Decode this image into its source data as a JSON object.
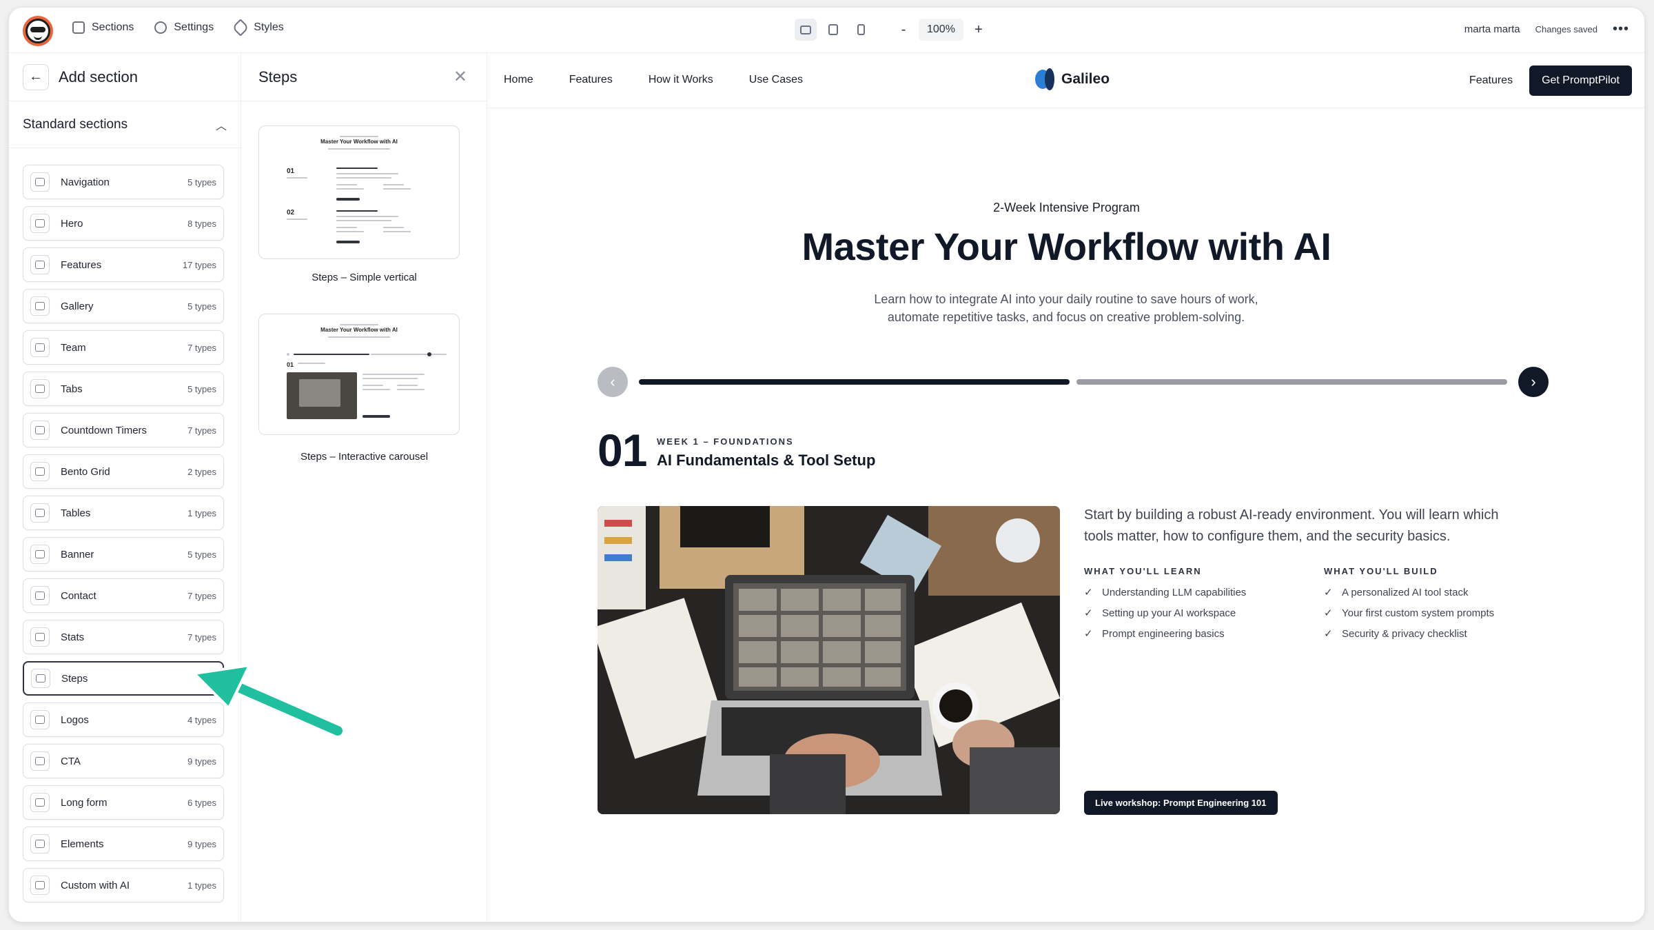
{
  "topbar": {
    "nav": [
      {
        "label": "Sections",
        "icon": "sections-icon"
      },
      {
        "label": "Settings",
        "icon": "gear-icon"
      },
      {
        "label": "Styles",
        "icon": "brush-icon"
      }
    ],
    "zoom_minus": "-",
    "zoom": "100%",
    "zoom_plus": "+",
    "user": "marta marta",
    "status": "Changes saved",
    "more": "•••"
  },
  "left_panel": {
    "title": "Add section",
    "group_title": "Standard sections",
    "items": [
      {
        "label": "Navigation",
        "count": "5 types",
        "icon": "navigation-icon"
      },
      {
        "label": "Hero",
        "count": "8 types",
        "icon": "hero-icon"
      },
      {
        "label": "Features",
        "count": "17 types",
        "icon": "features-icon"
      },
      {
        "label": "Gallery",
        "count": "5 types",
        "icon": "gallery-icon"
      },
      {
        "label": "Team",
        "count": "7 types",
        "icon": "team-icon"
      },
      {
        "label": "Tabs",
        "count": "5 types",
        "icon": "tabs-icon"
      },
      {
        "label": "Countdown Timers",
        "count": "7 types",
        "icon": "timer-icon"
      },
      {
        "label": "Bento Grid",
        "count": "2 types",
        "icon": "bento-grid-icon"
      },
      {
        "label": "Tables",
        "count": "1 types",
        "icon": "table-icon"
      },
      {
        "label": "Banner",
        "count": "5 types",
        "icon": "banner-icon"
      },
      {
        "label": "Contact",
        "count": "7 types",
        "icon": "phone-icon"
      },
      {
        "label": "Stats",
        "count": "7 types",
        "icon": "stats-icon"
      },
      {
        "label": "Steps",
        "count": "2",
        "icon": "steps-icon"
      },
      {
        "label": "Logos",
        "count": "4 types",
        "icon": "logos-icon"
      },
      {
        "label": "CTA",
        "count": "9 types",
        "icon": "cta-icon"
      },
      {
        "label": "Long form",
        "count": "6 types",
        "icon": "long-form-icon"
      },
      {
        "label": "Elements",
        "count": "9 types",
        "icon": "elements-icon"
      },
      {
        "label": "Custom with AI",
        "count": "1 types",
        "icon": "rocket-icon"
      }
    ]
  },
  "steps_panel": {
    "title": "Steps",
    "thumbs": [
      {
        "caption": "Steps – Simple vertical",
        "mini_title": "Master Your Workflow with AI",
        "n1": "01",
        "n2": "02"
      },
      {
        "caption": "Steps – Interactive carousel",
        "mini_title": "Master Your Workflow with AI",
        "n1": "01"
      }
    ]
  },
  "site": {
    "links": [
      "Home",
      "Features",
      "How it Works",
      "Use Cases"
    ],
    "brand": "Galileo",
    "right_link": "Features",
    "cta": "Get PromptPilot",
    "eyebrow": "2-Week Intensive Program",
    "title": "Master Your Workflow with AI",
    "subtitle": "Learn how to integrate AI into your daily routine to save hours of work, automate repetitive tasks, and focus on creative problem-solving.",
    "progress": {
      "current_step": 1,
      "total_steps": 2,
      "active_color": "#111827",
      "inactive_color": "#9a9ca3"
    },
    "step": {
      "number": "01",
      "eyebrow": "WEEK 1 – FOUNDATIONS",
      "title": "AI Fundamentals & Tool Setup",
      "description": "Start by building a robust AI-ready environment. You will learn which tools matter, how to configure them, and the security basics.",
      "learn_head": "WHAT YOU'LL LEARN",
      "learn": [
        "Understanding LLM capabilities",
        "Setting up your AI workspace",
        "Prompt engineering basics"
      ],
      "build_head": "WHAT YOU'LL BUILD",
      "build": [
        "A personalized AI tool stack",
        "Your first custom system prompts",
        "Security & privacy checklist"
      ],
      "workshop": "Live workshop: Prompt Engineering 101"
    }
  },
  "colors": {
    "arrow": "#1fbf9f",
    "dark": "#111827",
    "accent_blue": "#2a7fd4"
  }
}
